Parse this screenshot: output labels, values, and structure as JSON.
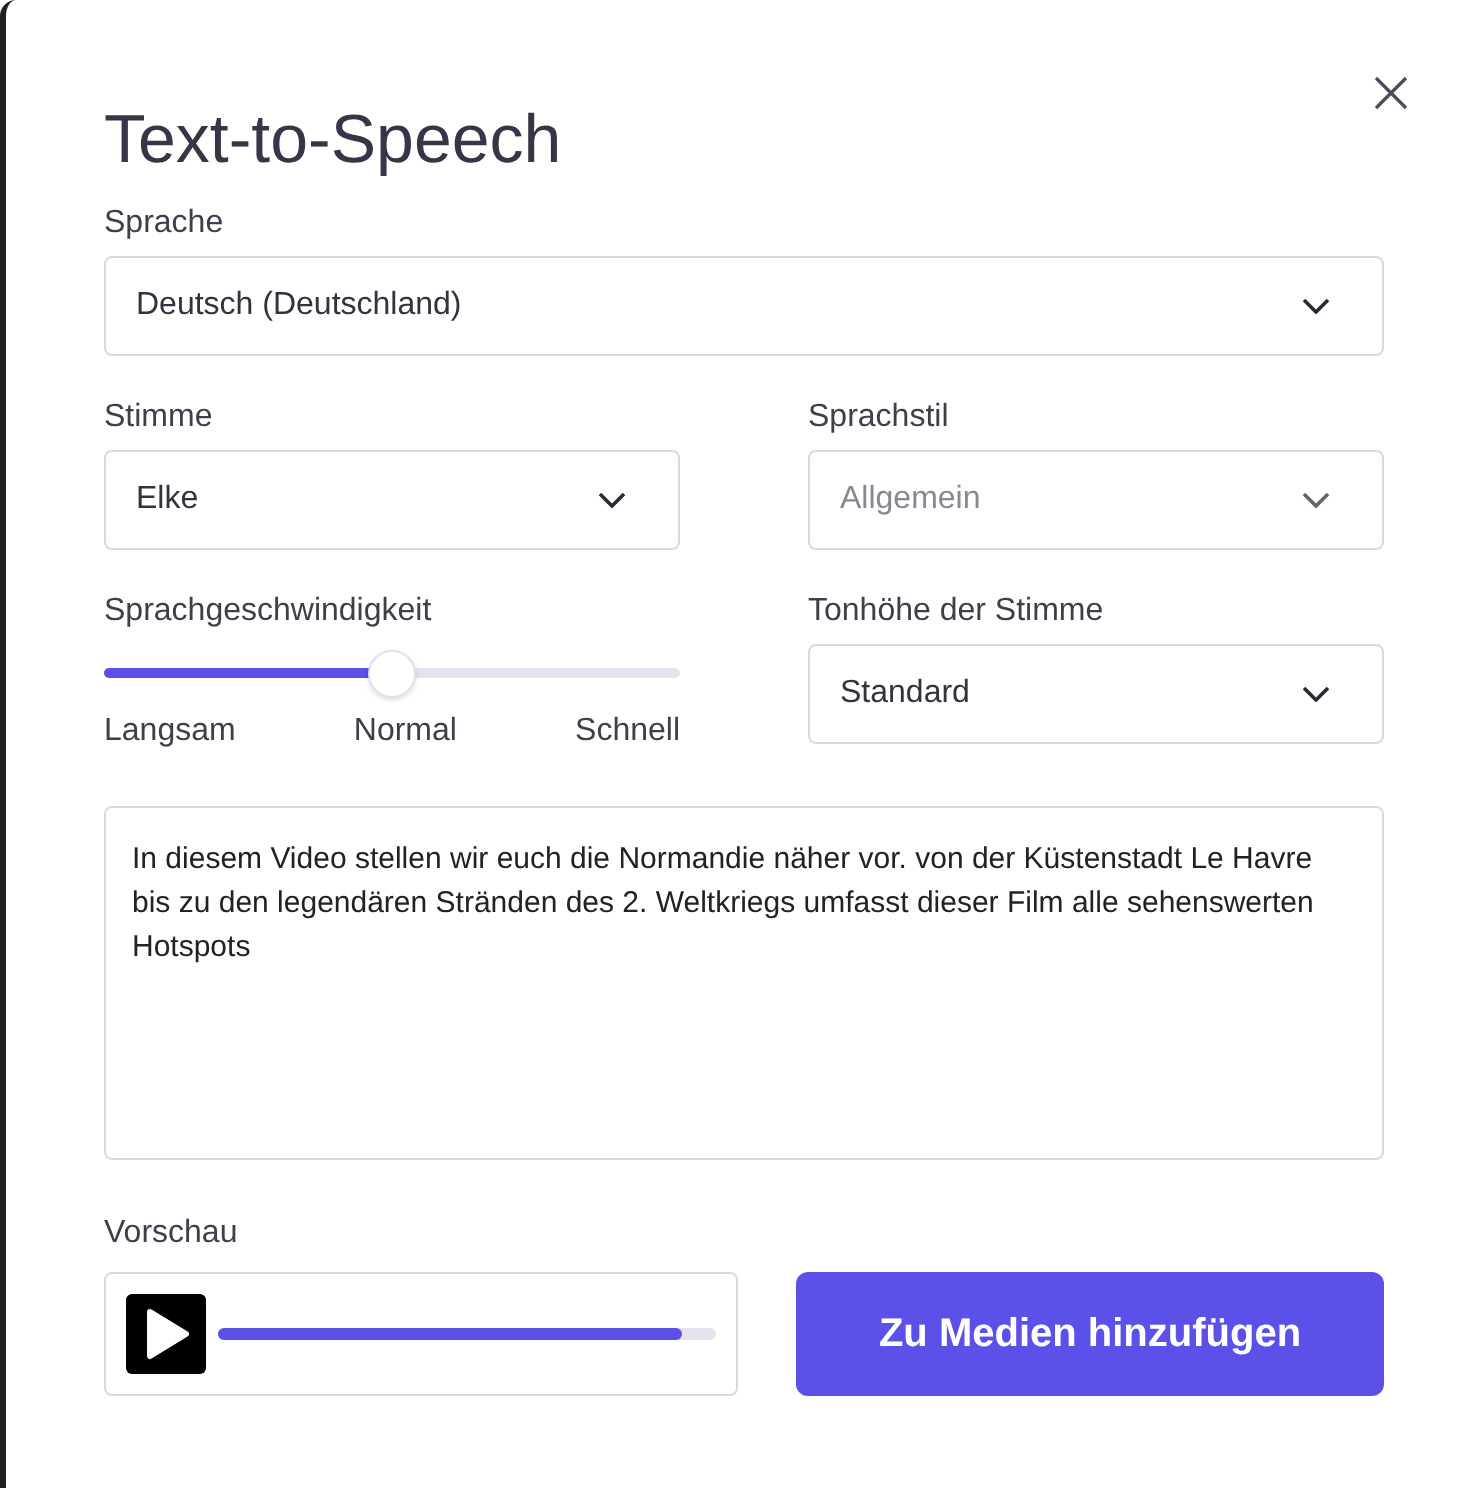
{
  "dialog": {
    "title": "Text-to-Speech"
  },
  "language": {
    "label": "Sprache",
    "value": "Deutsch (Deutschland)",
    "disabled": false
  },
  "voice": {
    "label": "Stimme",
    "value": "Elke",
    "disabled": false
  },
  "style": {
    "label": "Sprachstil",
    "value": "Allgemein",
    "disabled": true
  },
  "speed": {
    "label": "Sprachgeschwindigkeit",
    "level": 0.5,
    "ticks": [
      "Langsam",
      "Normal",
      "Schnell"
    ]
  },
  "pitch": {
    "label": "Tonhöhe der Stimme",
    "value": "Standard",
    "disabled": false
  },
  "text": {
    "value": "In diesem Video stellen wir euch die Normandie näher vor. von der Küstenstadt Le Havre bis zu den legendären Stränden des 2. Weltkriegs umfasst dieser Film alle sehenswerten Hotspots"
  },
  "preview": {
    "label": "Vorschau",
    "level": 0.93
  },
  "add_button": {
    "label": "Zu Medien hinzufügen"
  }
}
